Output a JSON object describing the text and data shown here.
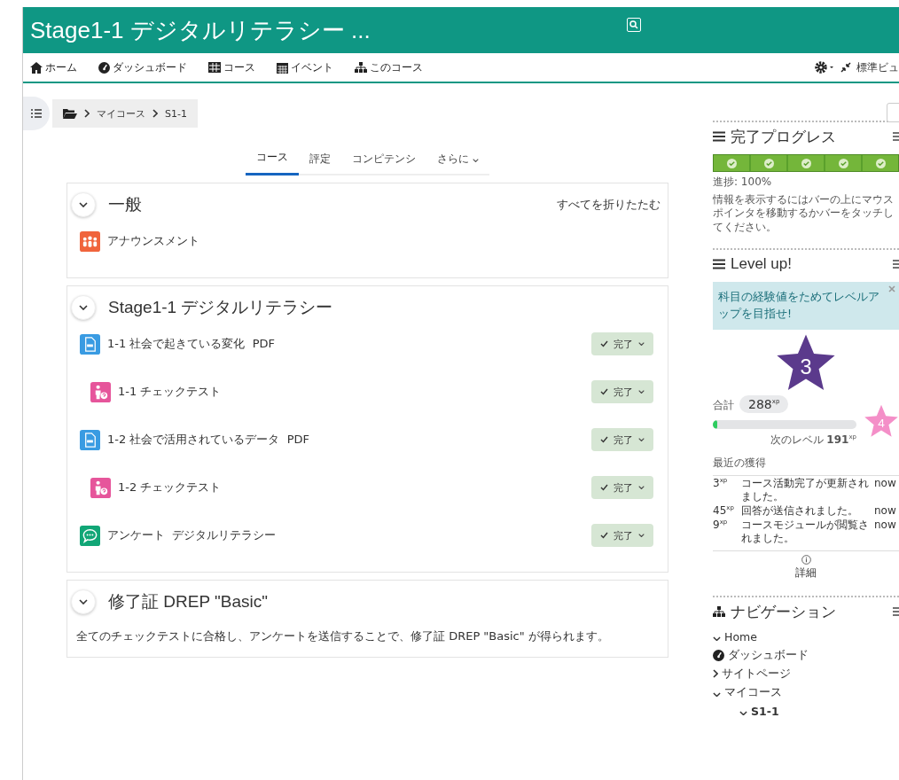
{
  "header": {
    "title": "Stage1-1 デジタルリテラシー ..."
  },
  "navbar": {
    "items": [
      {
        "kind": "home",
        "label": "ホーム"
      },
      {
        "kind": "dashboard",
        "label": "ダッシュボード"
      },
      {
        "kind": "grid",
        "label": "コース"
      },
      {
        "kind": "calendar",
        "label": "イベント"
      },
      {
        "kind": "sitemap",
        "label": "このコース"
      }
    ],
    "view_label": "標準ビュ"
  },
  "breadcrumb": [
    "マイコース",
    "S1-1"
  ],
  "tabs": [
    {
      "label": "コース",
      "selected": true,
      "dropdown": false
    },
    {
      "label": "評定",
      "selected": false,
      "dropdown": false
    },
    {
      "label": "コンピテンシ",
      "selected": false,
      "dropdown": false
    },
    {
      "label": "さらに",
      "selected": false,
      "dropdown": true
    }
  ],
  "sections": [
    {
      "title": "一般",
      "expanded": true,
      "collapse_all": "すべてを折りたたむ",
      "activities": [
        {
          "kind": "forum",
          "name": "アナウンスメント",
          "indented": false
        }
      ]
    },
    {
      "title": "Stage1-1 デジタルリテラシー",
      "expanded": true,
      "activities": [
        {
          "kind": "pdf",
          "name": "1-1 社会で起きている変化  PDF",
          "indented": false,
          "completion": {
            "label": "完了",
            "done": true
          }
        },
        {
          "kind": "quiz",
          "name": "1-1 チェックテスト",
          "indented": true,
          "completion": {
            "label": "完了",
            "done": true
          }
        },
        {
          "kind": "pdf",
          "name": "1-2 社会で活用されているデータ  PDF",
          "indented": false,
          "completion": {
            "label": "完了",
            "done": true
          }
        },
        {
          "kind": "quiz",
          "name": "1-2 チェックテスト",
          "indented": true,
          "completion": {
            "label": "完了",
            "done": true
          }
        },
        {
          "kind": "feedback",
          "name": "アンケート  デジタルリテラシー",
          "indented": false,
          "completion": {
            "label": "完了",
            "done": true
          }
        }
      ]
    },
    {
      "title": "修了証 DREP \"Basic\"",
      "expanded": true,
      "summary": "全てのチェックテストに合格し、アンケートを送信することで、修了証 DREP \"Basic\" が得られます。"
    }
  ],
  "completion_progress": {
    "title": "完了プログレス",
    "segments": [
      {
        "completed": true
      },
      {
        "completed": true
      },
      {
        "completed": true
      },
      {
        "completed": true
      },
      {
        "completed": true
      }
    ],
    "progress_text": "進捗: 100%",
    "hint": "情報を表示するにはバーの上にマウスポインタを移動するかバーをタッチしてください。"
  },
  "level_up": {
    "title": "Level up!",
    "notice": "科目の経験値をためてレベルアップを目指せ!",
    "level": "3",
    "total_label": "合計",
    "total": "288$^{xp}$",
    "progress": {
      "level": 0.03
    },
    "next_label": "次のレベル",
    "next_xp": "**191**$^{xp}$",
    "next_level": "4",
    "recent_label": "最近の獲得",
    "recent": [
      {
        "xp": "3$^{xp}$",
        "text": "コース活動完了が更新されました。",
        "time": "now"
      },
      {
        "xp": "45$^{xp}$",
        "text": "回答が送信されました。",
        "time": "now"
      },
      {
        "xp": "9$^{xp}$",
        "text": "コースモジュールが閲覧されました。",
        "time": "now"
      }
    ],
    "details": "詳細"
  },
  "navigation": {
    "title": "ナビゲーション",
    "items": [
      {
        "label": "Home",
        "expanded": true,
        "bold": false
      },
      {
        "label": "ダッシュボード",
        "kind": "dashboard",
        "bold": false
      },
      {
        "label": "サイトページ",
        "expanded": false,
        "bold": false
      },
      {
        "label": "マイコース",
        "expanded": true,
        "bold": false,
        "children": [
          {
            "label": "S1-1",
            "expanded": true,
            "bold": true
          }
        ]
      }
    ]
  }
}
